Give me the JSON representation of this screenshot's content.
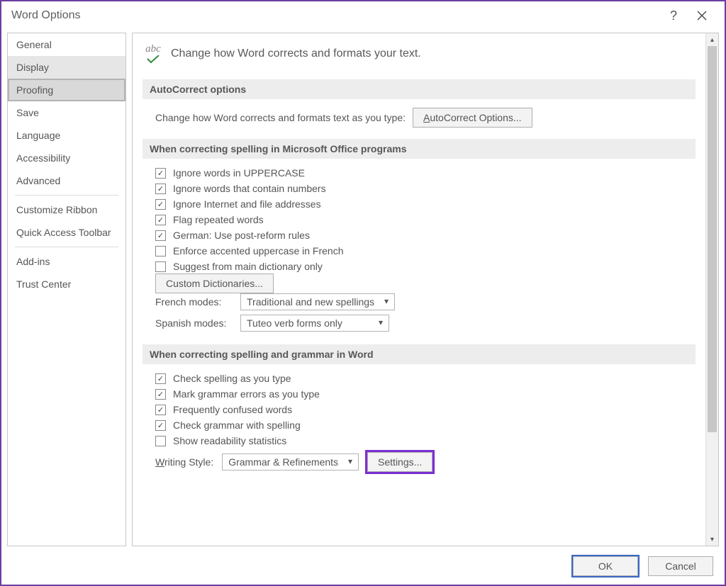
{
  "window": {
    "title": "Word Options",
    "help": "?",
    "close": "✕"
  },
  "sidebar": {
    "items": [
      {
        "label": "General"
      },
      {
        "label": "Display",
        "hover": true
      },
      {
        "label": "Proofing",
        "active": true
      },
      {
        "label": "Save"
      },
      {
        "label": "Language"
      },
      {
        "label": "Accessibility"
      },
      {
        "label": "Advanced"
      },
      {
        "sep": true
      },
      {
        "label": "Customize Ribbon"
      },
      {
        "label": "Quick Access Toolbar"
      },
      {
        "sep": true
      },
      {
        "label": "Add-ins"
      },
      {
        "label": "Trust Center"
      }
    ]
  },
  "intro": "Change how Word corrects and formats your text.",
  "section_autocorrect": {
    "header": "AutoCorrect options",
    "text": "Change how Word corrects and formats text as you type:",
    "button": "AutoCorrect Options..."
  },
  "section_office": {
    "header": "When correcting spelling in Microsoft Office programs",
    "checks": [
      {
        "label": "Ignore words in UPPERCASE",
        "checked": true
      },
      {
        "label": "Ignore words that contain numbers",
        "checked": true
      },
      {
        "label": "Ignore Internet and file addresses",
        "checked": true
      },
      {
        "label": "Flag repeated words",
        "checked": true
      },
      {
        "label": "German: Use post-reform rules",
        "checked": true
      },
      {
        "label": "Enforce accented uppercase in French",
        "checked": false
      },
      {
        "label": "Suggest from main dictionary only",
        "checked": false
      }
    ],
    "custom_dict_btn": "Custom Dictionaries...",
    "french_label": "French modes:",
    "french_value": "Traditional and new spellings",
    "spanish_label": "Spanish modes:",
    "spanish_value": "Tuteo verb forms only"
  },
  "section_word": {
    "header": "When correcting spelling and grammar in Word",
    "checks": [
      {
        "label": "Check spelling as you type",
        "checked": true
      },
      {
        "label": "Mark grammar errors as you type",
        "checked": true
      },
      {
        "label": "Frequently confused words",
        "checked": true
      },
      {
        "label": "Check grammar with spelling",
        "checked": true
      },
      {
        "label": "Show readability statistics",
        "checked": false
      }
    ],
    "writing_label": "Writing Style:",
    "writing_value": "Grammar & Refinements",
    "settings_btn": "Settings..."
  },
  "footer": {
    "ok": "OK",
    "cancel": "Cancel"
  }
}
